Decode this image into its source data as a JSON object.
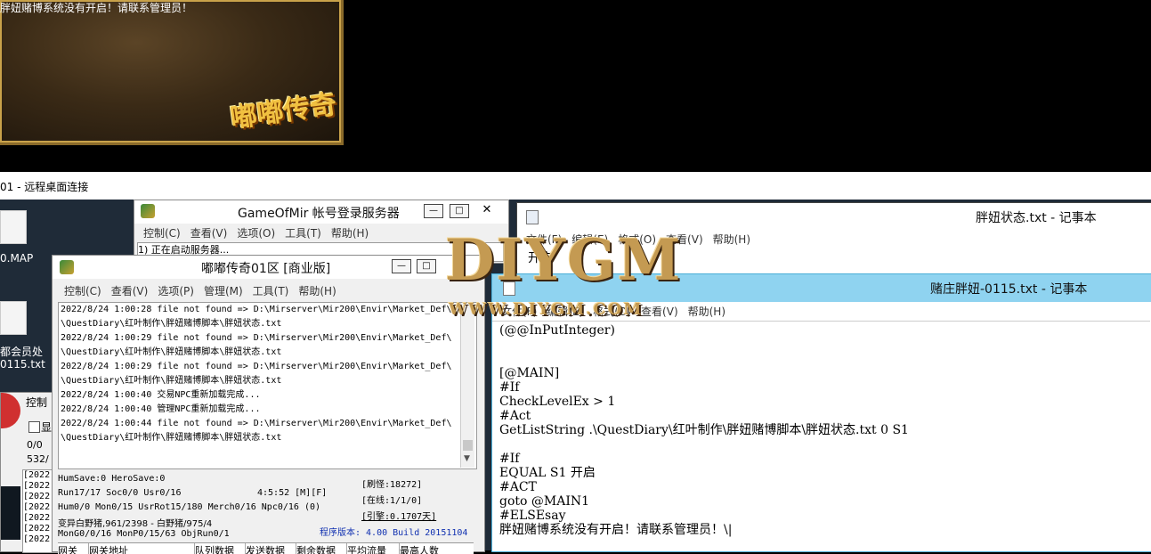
{
  "game": {
    "message": "胖妞赌博系统没有开启！请联系管理员！",
    "logo": "嘟嘟传奇"
  },
  "rdp": {
    "title": "01 - 远程桌面连接"
  },
  "desktop": {
    "icons": [
      {
        "label": "0.MAP"
      },
      {
        "label": "都会员处"
      },
      {
        "label": "0115.txt"
      }
    ]
  },
  "login_server": {
    "title": "GameOfMir 帐号登录服务器",
    "menu": [
      "控制(C)",
      "查看(V)",
      "选项(O)",
      "工具(T)",
      "帮助(H)"
    ],
    "log_line": "1) 正在启动服务器..."
  },
  "dudu": {
    "title": "嘟嘟传奇01区 [商业版]",
    "menu": [
      "控制(C)",
      "查看(V)",
      "选项(P)",
      "管理(M)",
      "工具(T)",
      "帮助(H)"
    ],
    "log": [
      "2022/8/24 1:00:28 file not found => D:\\Mirserver\\Mir200\\Envir\\Market_Def\\",
      "\\QuestDiary\\红叶制作\\胖妞赌博脚本\\胖妞状态.txt",
      "2022/8/24 1:00:29 file not found => D:\\Mirserver\\Mir200\\Envir\\Market_Def\\",
      "\\QuestDiary\\红叶制作\\胖妞赌博脚本\\胖妞状态.txt",
      "2022/8/24 1:00:29 file not found => D:\\Mirserver\\Mir200\\Envir\\Market_Def\\",
      "\\QuestDiary\\红叶制作\\胖妞赌博脚本\\胖妞状态.txt",
      "2022/8/24 1:00:40 交易NPC重新加载完成...",
      "2022/8/24 1:00:40 管理NPC重新加载完成...",
      "2022/8/24 1:00:44 file not found => D:\\Mirserver\\Mir200\\Envir\\Market_Def\\",
      "\\QuestDiary\\红叶制作\\胖妞赌博脚本\\胖妞状态.txt"
    ],
    "stats": {
      "line1": "HumSave:0 HeroSave:0",
      "line2": "Run17/17 Soc0/0 Usr0/16",
      "time": "4:5:52 [M][F]",
      "line3": "Hum0/0 Mon0/15 UsrRot15/180 Merch0/16 Npc0/16 (0)",
      "line4": "变异白野猪,961/2398 - 白野猪/975/4",
      "line5": "MonG0/0/16 MonP0/15/63 ObjRun0/1",
      "refresh": "[刷怪:18272]",
      "online": "[在线:1/1/0]",
      "engine": "[引擎:0.1707天]",
      "version": "程序版本: 4.00 Build 20151104"
    },
    "table_headers": [
      "网关",
      "网关地址",
      "队列数据",
      "发送数据",
      "剩余数据",
      "平均流量",
      "最高人数"
    ]
  },
  "small_win": {
    "menu": "控制",
    "checkbox_label": "显",
    "lines": [
      "0/0",
      "532/",
      "[2022",
      "[2022",
      "[2022",
      "[2022",
      "[2022",
      "[2022",
      "[2022",
      "[2022"
    ]
  },
  "notepad_status": {
    "title": "胖妞状态.txt - 记事本",
    "menu": [
      "文件(F)",
      "编辑(E)",
      "格式(O)",
      "查看(V)",
      "帮助(H)"
    ],
    "content": "开启"
  },
  "notepad_script": {
    "title": "赌庄胖妞-0115.txt - 记事本",
    "menu": [
      "文件(F)",
      "编辑(E)",
      "格式(O)",
      "查看(V)",
      "帮助(H)"
    ],
    "lines": [
      "(@@InPutInteger)",
      "",
      "",
      "[@MAIN]",
      "#If",
      "CheckLevelEx > 1",
      "#Act",
      "GetListString .\\QuestDiary\\红叶制作\\胖妞赌博脚本\\胖妞状态.txt 0 S1",
      "",
      "#If",
      "EQUAL S1 开启",
      "#ACT",
      "goto @MAIN1",
      "#ELSEsay",
      "胖妞赌博系统没有开启！请联系管理员！\\|"
    ]
  },
  "watermark": {
    "logo": "DIYGM",
    "url": "WWW.DIYGM.COM"
  }
}
